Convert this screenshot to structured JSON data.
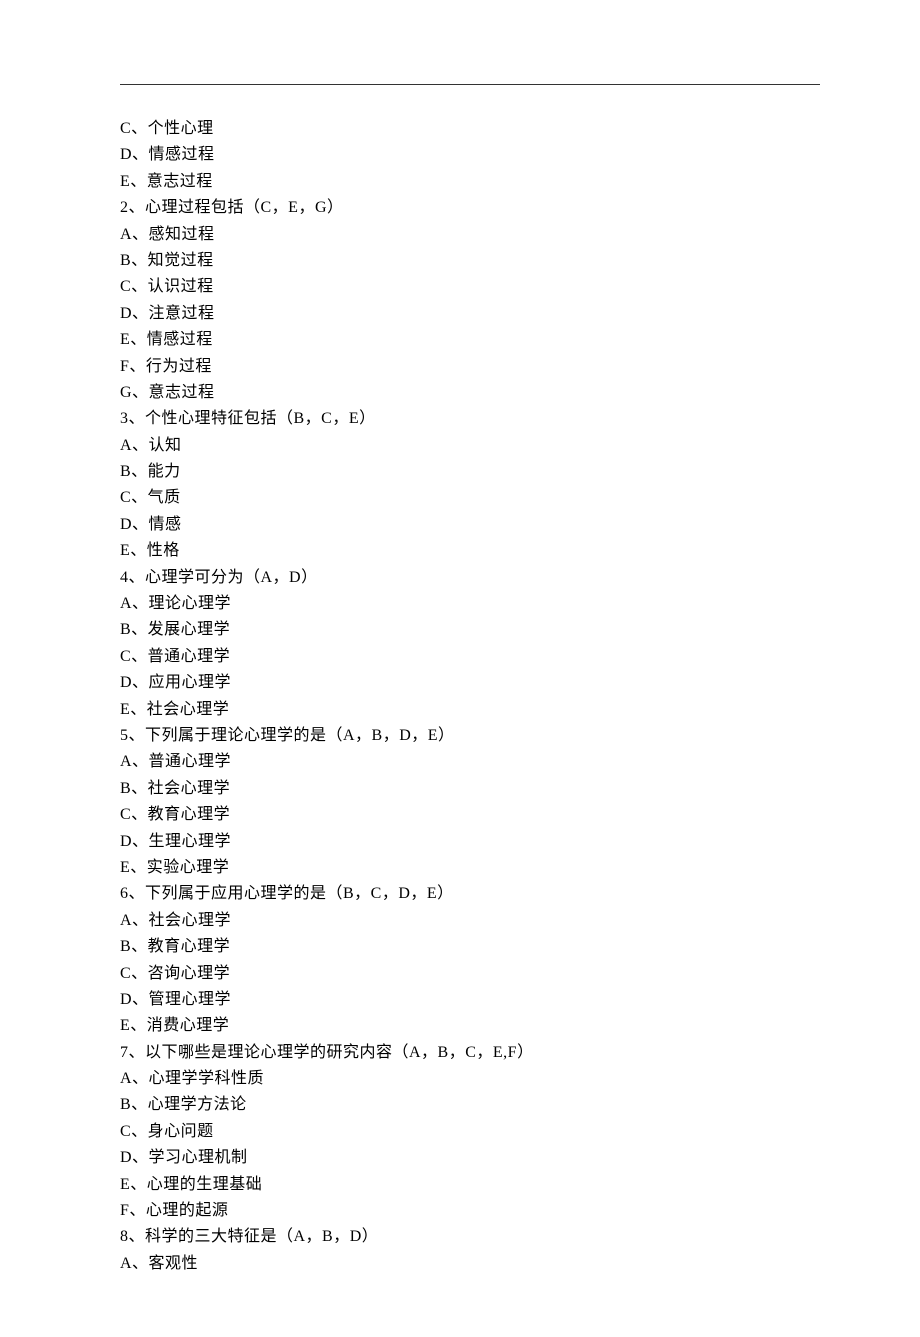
{
  "lines": [
    "C、个性心理",
    "D、情感过程",
    "E、意志过程",
    "2、心理过程包括（C，E，G）",
    "A、感知过程",
    "B、知觉过程",
    "C、认识过程",
    "D、注意过程",
    "E、情感过程",
    "F、行为过程",
    "G、意志过程",
    "3、个性心理特征包括（B，C，E）",
    "A、认知",
    "B、能力",
    "C、气质",
    "D、情感",
    "E、性格",
    "4、心理学可分为（A，D）",
    "A、理论心理学",
    "B、发展心理学",
    "C、普通心理学",
    "D、应用心理学",
    "E、社会心理学",
    "5、下列属于理论心理学的是（A，B，D，E）",
    "A、普通心理学",
    "B、社会心理学",
    "C、教育心理学",
    "D、生理心理学",
    "E、实验心理学",
    "6、下列属于应用心理学的是（B，C，D，E）",
    "A、社会心理学",
    "B、教育心理学",
    "C、咨询心理学",
    "D、管理心理学",
    "E、消费心理学",
    "7、以下哪些是理论心理学的研究内容（A，B，C，E,F）",
    "A、心理学学科性质",
    "B、心理学方法论",
    "C、身心问题",
    "D、学习心理机制",
    "E、心理的生理基础",
    "F、心理的起源",
    "8、科学的三大特征是（A，B，D）",
    "A、客观性"
  ]
}
